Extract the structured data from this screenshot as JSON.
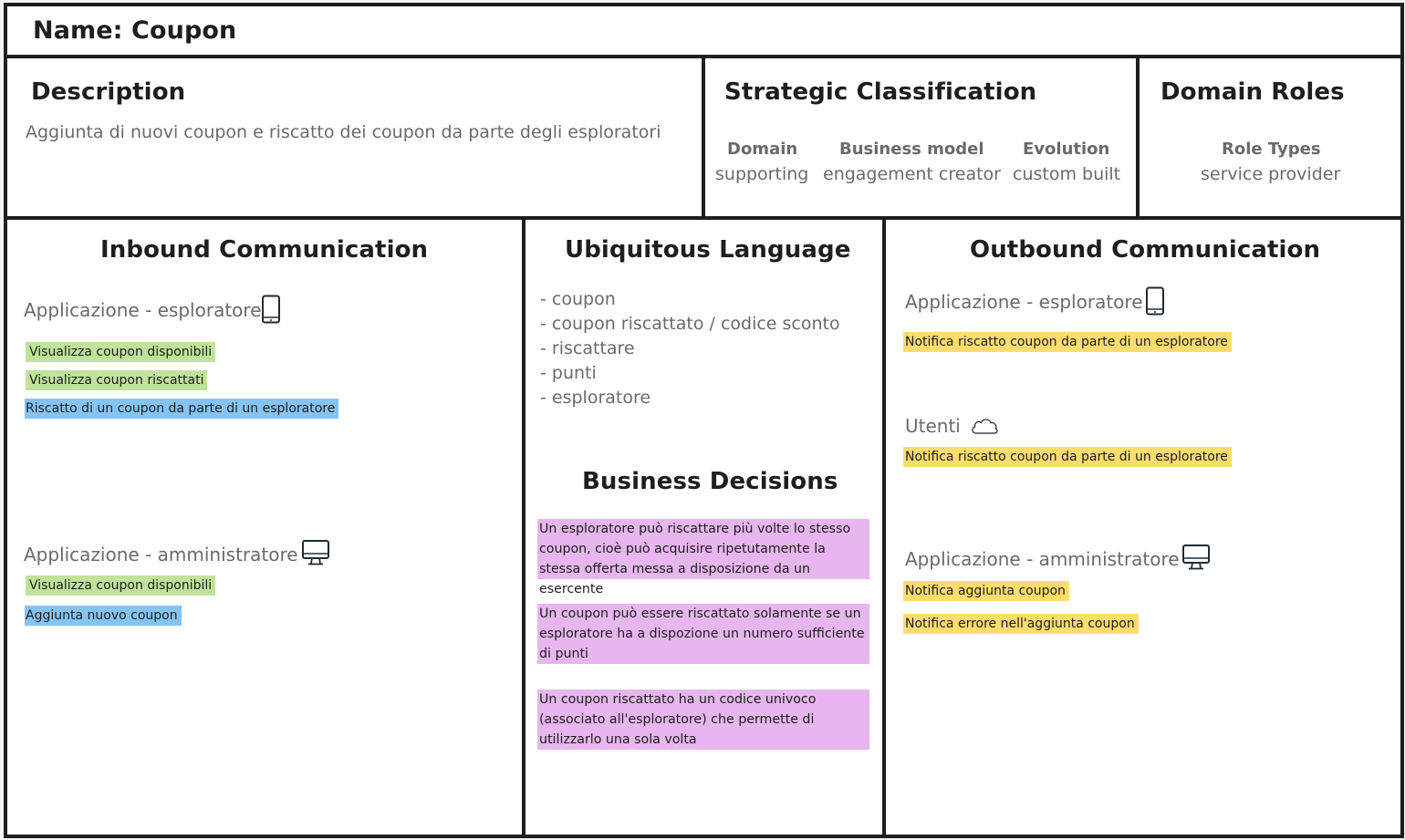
{
  "name": {
    "label": "Name: Coupon"
  },
  "description": {
    "title": "Description",
    "text": "Aggiunta di nuovi coupon e riscatto dei coupon da parte degli esploratori"
  },
  "strategic": {
    "title": "Strategic Classification",
    "columns": [
      {
        "label": "Domain",
        "value": "supporting"
      },
      {
        "label": "Business model",
        "value": "engagement creator"
      },
      {
        "label": "Evolution",
        "value": "custom built"
      }
    ]
  },
  "roles": {
    "title": "Domain Roles",
    "label": "Role Types",
    "value": "service provider"
  },
  "inbound": {
    "title": "Inbound Communication",
    "groups": [
      {
        "heading": "Applicazione - esploratore",
        "icon": "mobile-phone-icon",
        "items": [
          {
            "text": "Visualizza coupon disponibili",
            "type": "query",
            "color": "#bfe39a"
          },
          {
            "text": "Visualizza coupon riscattati",
            "type": "query",
            "color": "#bfe39a"
          },
          {
            "text": "Riscatto di un coupon da parte di un esploratore",
            "type": "command",
            "color": "#84c4f5"
          }
        ]
      },
      {
        "heading": "Applicazione - amministratore",
        "icon": "desktop-monitor-icon",
        "items": [
          {
            "text": "Visualizza coupon disponibili",
            "type": "query",
            "color": "#bfe39a"
          },
          {
            "text": "Aggiunta nuovo coupon",
            "type": "command",
            "color": "#84c4f5"
          }
        ]
      }
    ]
  },
  "ubiquitous": {
    "title": "Ubiquitous Language",
    "terms": [
      "- coupon",
      "- coupon riscattato / codice sconto",
      "- riscattare",
      "- punti",
      "- esploratore"
    ]
  },
  "decisions": {
    "title": "Business Decisions",
    "color": "#e7b6ee",
    "items": [
      "Un esploratore può riscattare più volte lo stesso coupon, cioè può acquisire ripetutamente la stessa offerta messa a disposizione da un esercente",
      "Un coupon può essere riscattato solamente se un esploratore ha a dispozione un numero sufficiente di punti",
      "Un coupon riscattato ha un codice univoco (associato all'esploratore) che permette di utilizzarlo una sola volta"
    ]
  },
  "outbound": {
    "title": "Outbound Communication",
    "groups": [
      {
        "heading": "Applicazione - esploratore",
        "icon": "mobile-phone-icon",
        "items": [
          {
            "text": "Notifica riscatto coupon da parte di un esploratore",
            "type": "event",
            "color": "#ffdc6e"
          }
        ]
      },
      {
        "heading": "Utenti",
        "icon": "cloud-icon",
        "items": [
          {
            "text": "Notifica riscatto coupon da parte di un esploratore",
            "type": "event",
            "color": "#ffdc6e"
          }
        ]
      },
      {
        "heading": "Applicazione - amministratore",
        "icon": "desktop-monitor-icon",
        "items": [
          {
            "text": "Notifica aggiunta coupon",
            "type": "event",
            "color": "#ffdc6e"
          },
          {
            "text": "Notifica errore nell'aggiunta coupon",
            "type": "event",
            "color": "#ffdc6e"
          }
        ]
      }
    ]
  }
}
